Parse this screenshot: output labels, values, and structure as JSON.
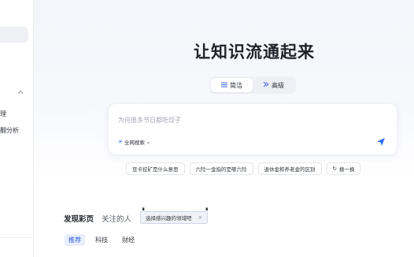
{
  "sidebar": {
    "fragments": [
      "理",
      "翻分析"
    ],
    "collapse_icon": "chevron-up"
  },
  "hero": {
    "title": "让知识流通起来"
  },
  "mode_switch": {
    "options": [
      {
        "label": "简洁",
        "icon": "list-icon",
        "active": true
      },
      {
        "label": "高级",
        "icon": "sparkle-icon",
        "active": false
      }
    ]
  },
  "search": {
    "placeholder": "为何很多节日都吃饺子",
    "value": "",
    "scope_label": "全网搜索",
    "accent": "#3b6cf6"
  },
  "suggestions": [
    "豆卡挖矿是什么意思",
    "六险一金指的是哪六险",
    "退休金和养老金的区别",
    "换一换"
  ],
  "feed": {
    "tabs": [
      {
        "label": "发现彩页",
        "active": true
      },
      {
        "label": "关注的人",
        "active": false
      }
    ],
    "tooltip": "选择感兴趣的领域吧",
    "sub_tabs": [
      {
        "label": "推荐",
        "active": true
      },
      {
        "label": "科技",
        "active": false
      },
      {
        "label": "财经",
        "active": false
      }
    ]
  }
}
